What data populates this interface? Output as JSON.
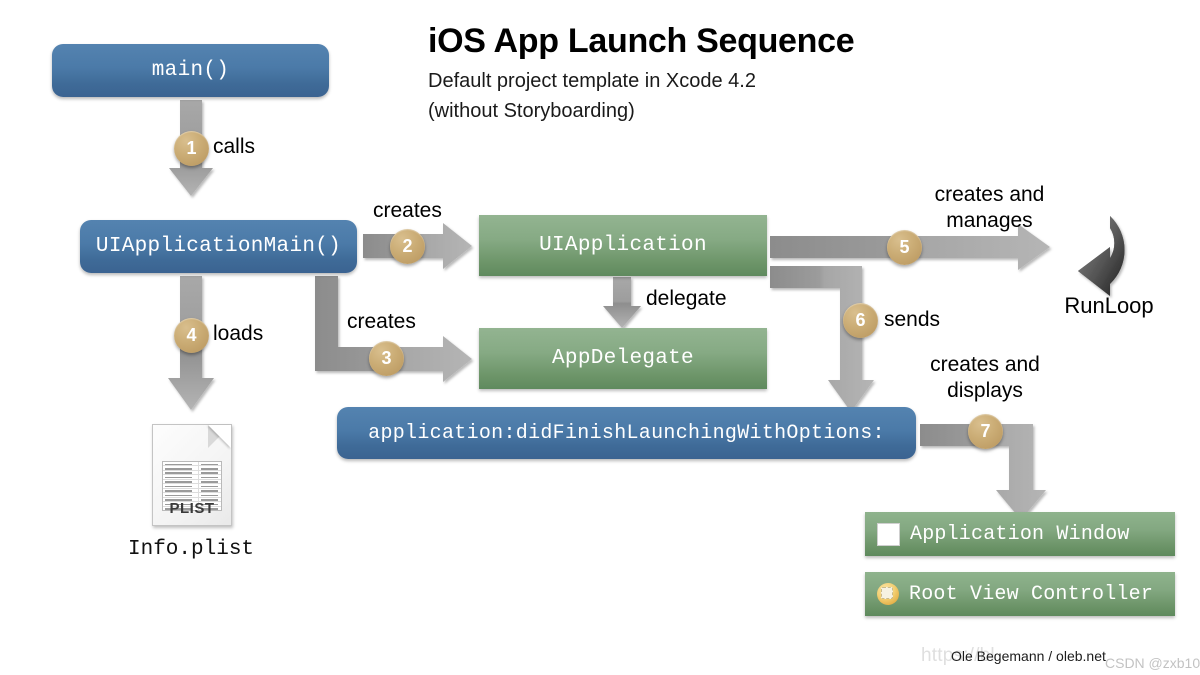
{
  "header": {
    "title": "iOS App Launch Sequence",
    "subtitle_line1": "Default project template in Xcode 4.2",
    "subtitle_line2": "(without Storyboarding)"
  },
  "nodes": {
    "main": "main()",
    "uiapplicationmain": "UIApplicationMain()",
    "uiapplication": "UIApplication",
    "appdelegate": "AppDelegate",
    "didfinishlaunching": "application:didFinishLaunchingWithOptions:",
    "runloop": "RunLoop",
    "infoplist_caption": "Info.plist",
    "plist_word": "PLIST",
    "application_window": "Application Window",
    "root_view_controller": "Root View Controller"
  },
  "steps": [
    {
      "number": "1",
      "label": "calls"
    },
    {
      "number": "2",
      "label": "creates"
    },
    {
      "number": "3",
      "label": "creates"
    },
    {
      "number": "4",
      "label": "loads"
    },
    {
      "number": "5",
      "label_line1": "creates and",
      "label_line2": "manages"
    },
    {
      "number": "6",
      "label": "sends"
    },
    {
      "number": "7",
      "label_line1": "creates and",
      "label_line2": "displays"
    }
  ],
  "edges": {
    "delegate_label": "delegate"
  },
  "footer": {
    "credit": "Ole Begemann / oleb.net",
    "watermark_url": "https://bl",
    "watermark_csdn": "CSDN @zxb10"
  },
  "colors": {
    "blue_box_top": "#5483b0",
    "blue_box_bottom": "#3b6391",
    "green_box_top": "#93b491",
    "green_box_bottom": "#5f8a5e",
    "badge": "#cbad76",
    "arrow_gray": "#9a9a9a",
    "background": "#ffffff"
  }
}
